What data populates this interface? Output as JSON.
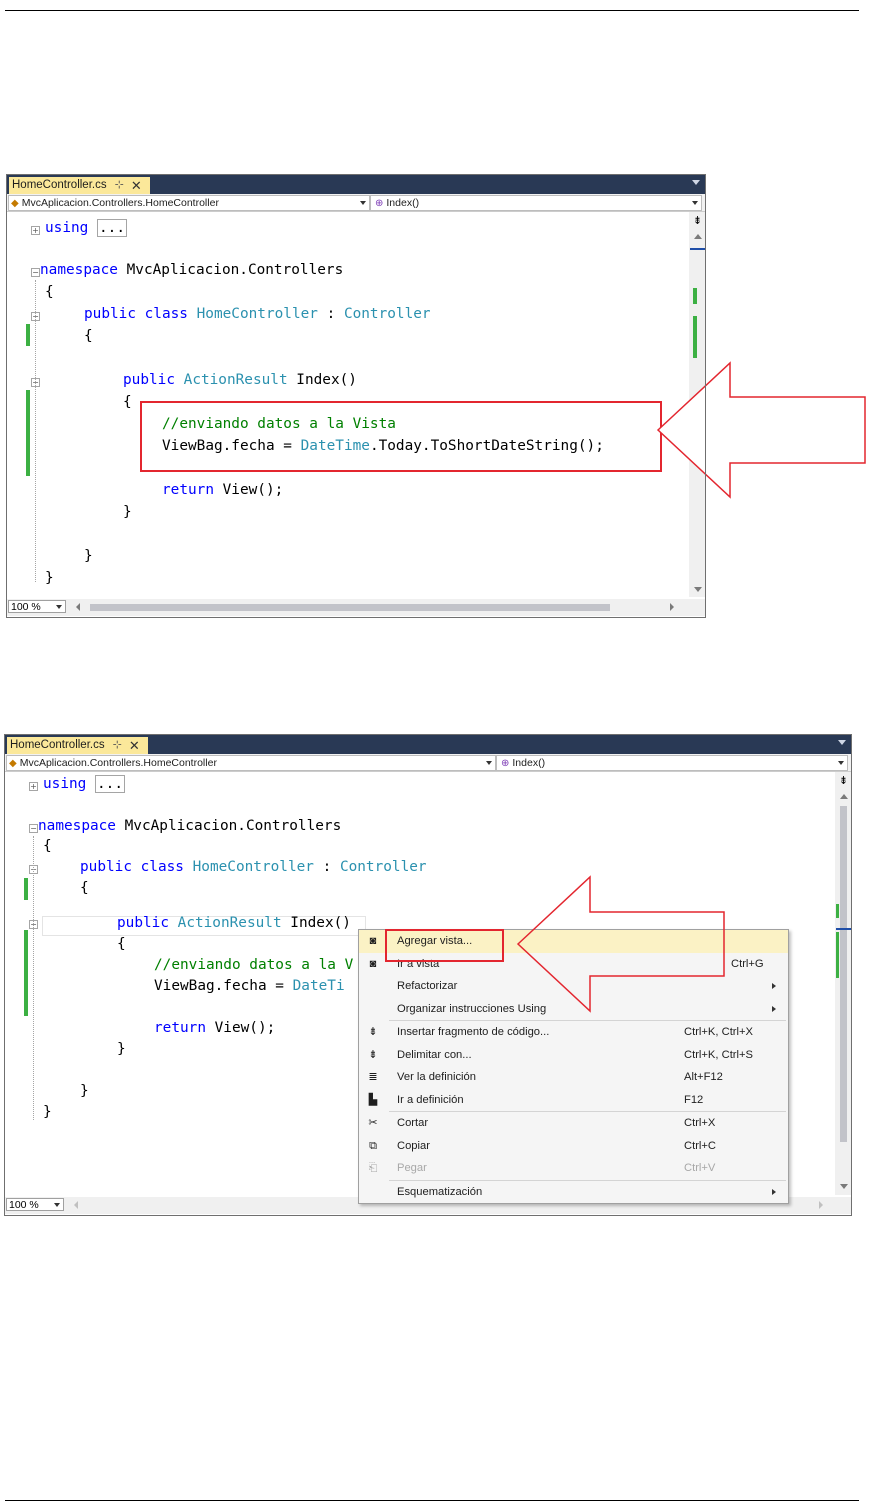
{
  "screenshot1": {
    "tab": {
      "title": "HomeController.cs",
      "pin": "⊹",
      "close": "✕"
    },
    "nav": {
      "left_combo": "MvcAplicacion.Controllers.HomeController",
      "right_combo": "Index()"
    },
    "code": {
      "using_kw": "using",
      "using_collapsed": "...",
      "ns_kw": "namespace",
      "ns_name": " MvcAplicacion.Controllers",
      "brace_open": "{",
      "brace_close": "}",
      "class_mods": "public class",
      "class_name": "HomeController",
      "class_sep": " : ",
      "base_type": "Controller",
      "method_mod": "public",
      "method_type": "ActionResult",
      "method_name": " Index()",
      "comment": "//enviando datos a la Vista",
      "viewbag_a": "ViewBag.fecha = ",
      "datetime": "DateTime",
      "viewbag_b": ".Today.ToShortDateString();",
      "return_kw": "return",
      "return_rest": " View();"
    },
    "zoom": "100 %"
  },
  "screenshot2": {
    "tab": {
      "title": "HomeController.cs",
      "pin": "⊹",
      "close": "✕"
    },
    "nav": {
      "left_combo": "MvcAplicacion.Controllers.HomeController",
      "right_combo": "Index()"
    },
    "code": {
      "using_kw": "using",
      "using_collapsed": "...",
      "ns_kw": "namespace",
      "ns_name": " MvcAplicacion.Controllers",
      "brace_open": "{",
      "brace_close": "}",
      "class_mods": "public class",
      "class_name": "HomeController",
      "class_sep": " : ",
      "base_type": "Controller",
      "method_mod": "public",
      "method_type": "ActionResult",
      "method_name": " Index()",
      "comment": "//enviando datos a la V",
      "viewbag_a": "ViewBag.fecha = ",
      "datetime": "DateTi",
      "return_kw": "return",
      "return_rest": " View();"
    },
    "zoom": "100 %",
    "context_menu": [
      {
        "label": "Agregar vista...",
        "shortcut": "",
        "icon": "add-view-icon",
        "glyph": "◙",
        "selected": true
      },
      {
        "label": "Ir a vista",
        "shortcut": "Ctrl+G",
        "icon": "go-to-view-icon",
        "glyph": "◙"
      },
      {
        "label": "Refactorizar",
        "shortcut": "",
        "submenu": true
      },
      {
        "label": "Organizar instrucciones Using",
        "shortcut": "",
        "submenu": true
      },
      {
        "label": "Insertar fragmento de código...",
        "shortcut": "Ctrl+K, Ctrl+X",
        "icon": "insert-snippet-icon",
        "glyph": "⇟"
      },
      {
        "label": "Delimitar con...",
        "shortcut": "Ctrl+K, Ctrl+S",
        "icon": "surround-with-icon",
        "glyph": "⇟"
      },
      {
        "label": "Ver la definición",
        "shortcut": "Alt+F12",
        "icon": "peek-definition-icon",
        "glyph": "≣"
      },
      {
        "label": "Ir a definición",
        "shortcut": "F12",
        "icon": "go-to-definition-icon",
        "glyph": "▙"
      },
      {
        "label": "Cortar",
        "shortcut": "Ctrl+X",
        "icon": "scissors-icon",
        "glyph": "✂"
      },
      {
        "label": "Copiar",
        "shortcut": "Ctrl+C",
        "icon": "copy-icon",
        "glyph": "⧉"
      },
      {
        "label": "Pegar",
        "shortcut": "Ctrl+V",
        "icon": "paste-icon",
        "glyph": "⎗",
        "disabled": true
      },
      {
        "label": "Esquematización",
        "shortcut": "",
        "submenu": true
      }
    ]
  },
  "colors": {
    "accent_red": "#e3262f",
    "tab_yellow": "#fbe89a",
    "tab_strip": "#293955",
    "change_green": "#3cb043"
  }
}
